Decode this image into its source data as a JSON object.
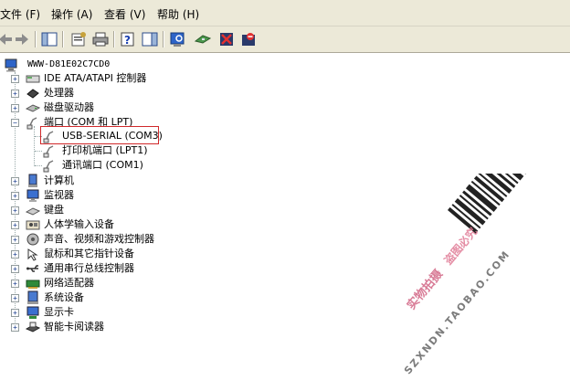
{
  "menu": {
    "file": "文件 (F)",
    "action": "操作 (A)",
    "view": "查看 (V)",
    "help": "帮助 (H)"
  },
  "toolbar": {
    "icons": [
      "back-icon",
      "forward-icon",
      "show-hide-tree-icon",
      "properties-icon",
      "print-icon",
      "help-icon",
      "show-hide-action-pane-icon",
      "scan-hardware-icon",
      "update-driver-icon",
      "uninstall-icon",
      "disable-icon"
    ]
  },
  "tree": {
    "root": "WWW-D81E02C7CD0",
    "items": [
      {
        "label": "IDE ATA/ATAPI 控制器",
        "icon": "ide-controller-icon"
      },
      {
        "label": "处理器",
        "icon": "processor-icon"
      },
      {
        "label": "磁盘驱动器",
        "icon": "disk-drive-icon"
      },
      {
        "label": "端口 (COM 和 LPT)",
        "icon": "port-icon"
      },
      {
        "label": "计算机",
        "icon": "computer-icon"
      },
      {
        "label": "监视器",
        "icon": "monitor-icon"
      },
      {
        "label": "键盘",
        "icon": "keyboard-icon"
      },
      {
        "label": "人体学输入设备",
        "icon": "hid-icon"
      },
      {
        "label": "声音、视频和游戏控制器",
        "icon": "sound-icon"
      },
      {
        "label": "鼠标和其它指针设备",
        "icon": "mouse-icon"
      },
      {
        "label": "通用串行总线控制器",
        "icon": "usb-icon"
      },
      {
        "label": "网络适配器",
        "icon": "network-adapter-icon"
      },
      {
        "label": "系统设备",
        "icon": "system-device-icon"
      },
      {
        "label": "显示卡",
        "icon": "display-adapter-icon"
      },
      {
        "label": "智能卡阅读器",
        "icon": "smart-card-reader-icon"
      }
    ],
    "ports": [
      {
        "label": "USB-SERIAL (COM3)"
      },
      {
        "label": "打印机端口 (LPT1)"
      },
      {
        "label": "通讯端口 (COM1)"
      }
    ]
  },
  "watermark": {
    "line1": "实物拍摄",
    "line2": "盗图必究",
    "shop": "SZXNDN.TAOBAO.COM"
  },
  "colors": {
    "menubar_bg": "#ece9d8",
    "selection_border": "#d0282a",
    "watermark": "#e07a95"
  }
}
